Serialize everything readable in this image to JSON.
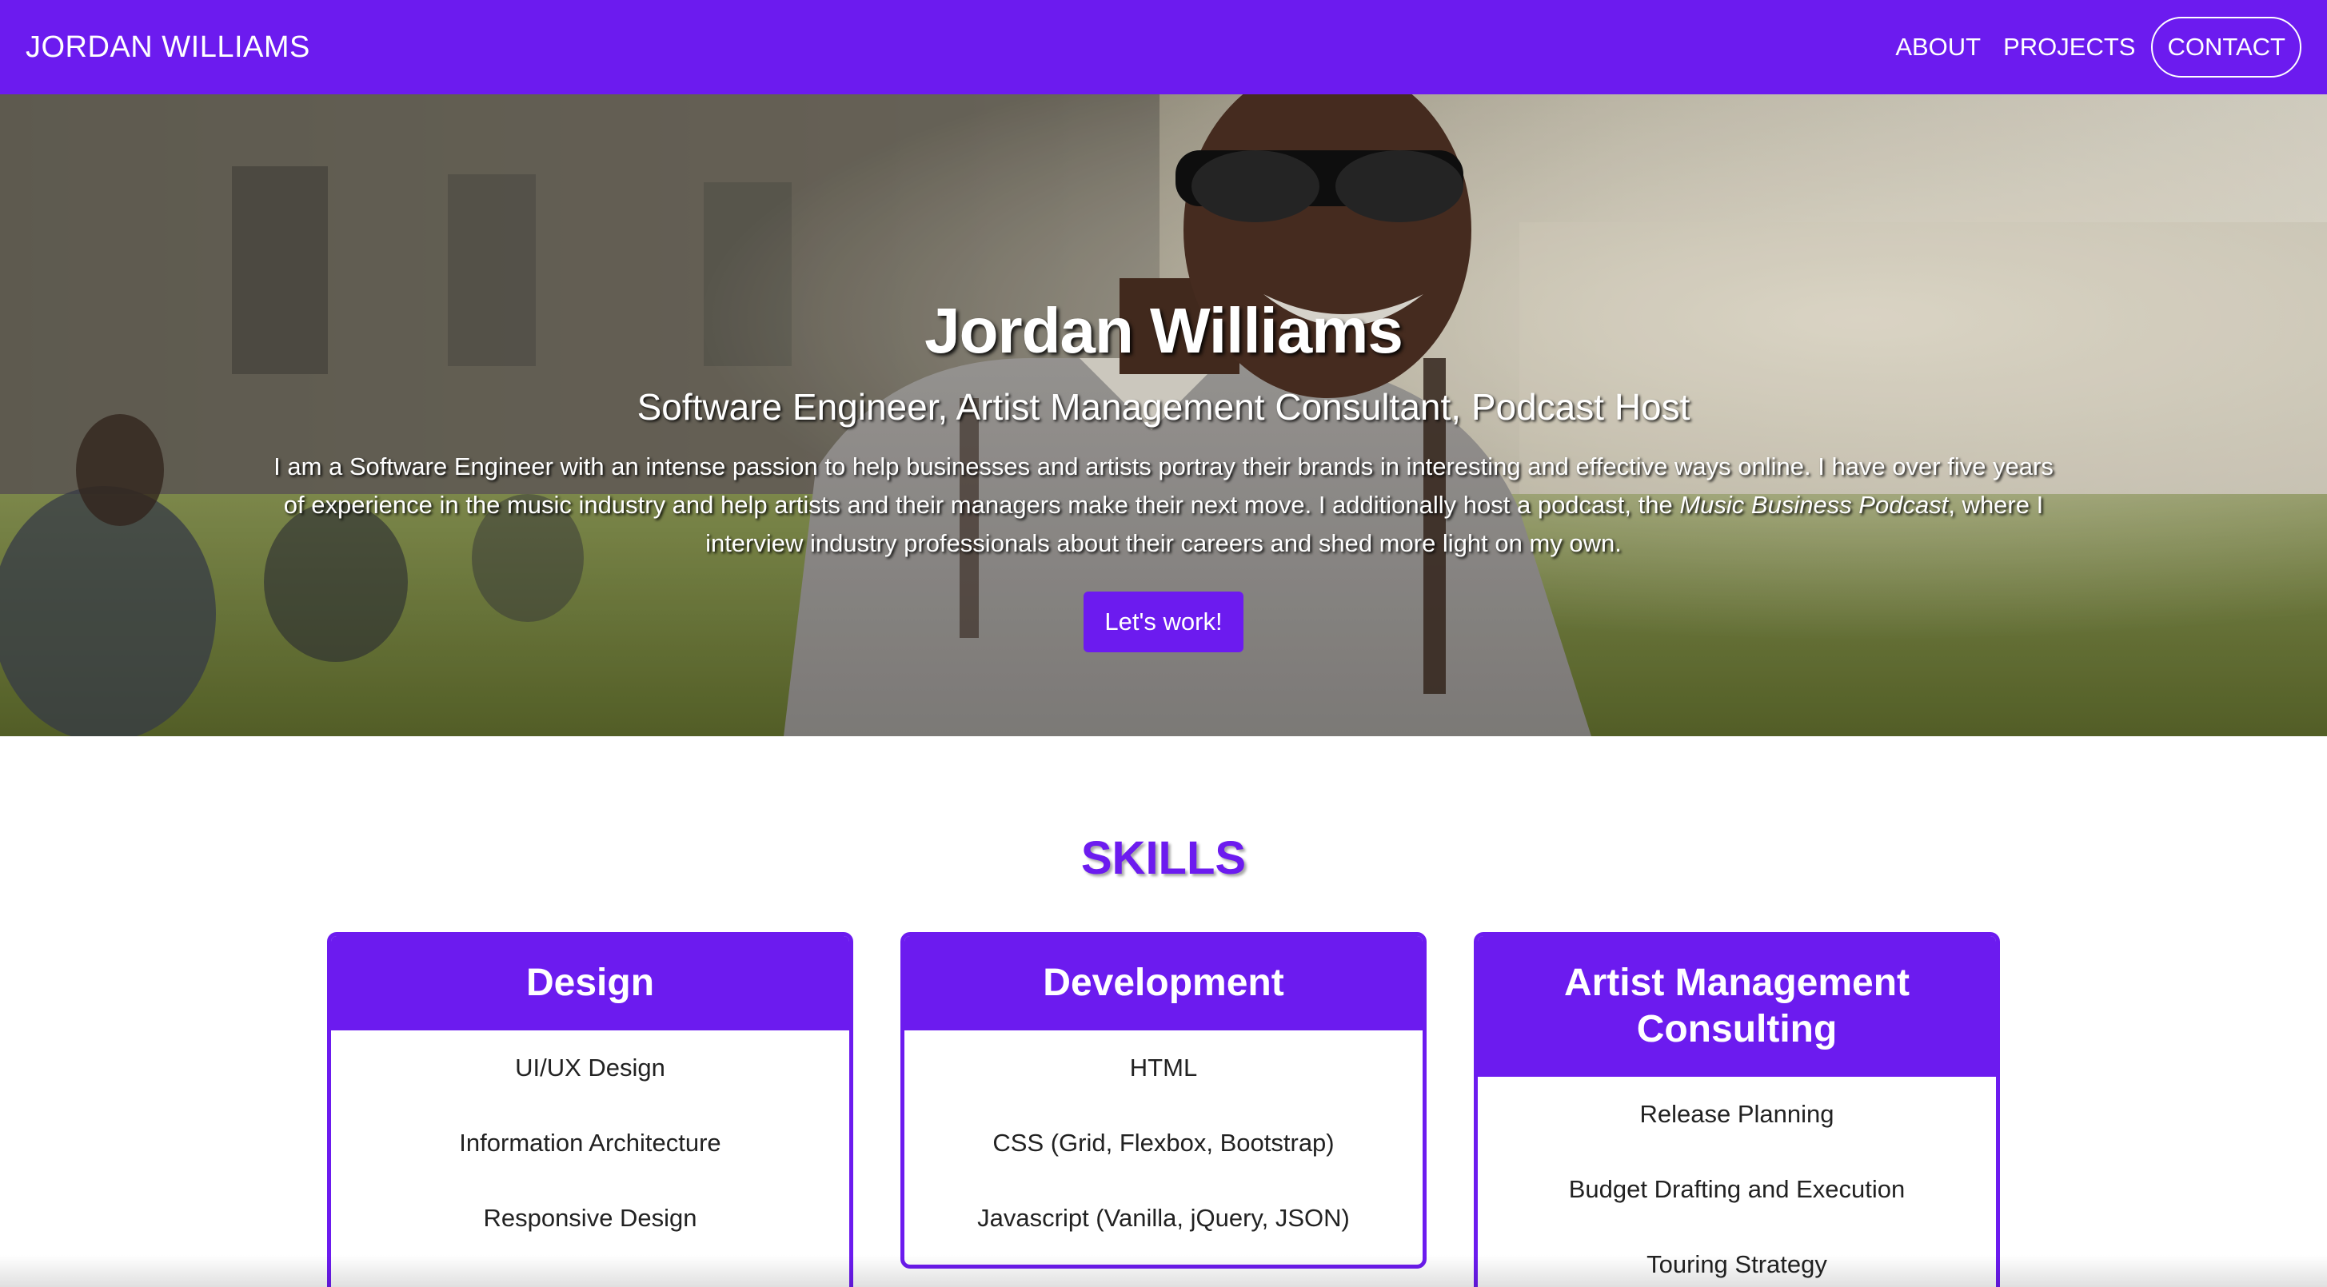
{
  "navbar": {
    "brand": "JORDAN WILLIAMS",
    "links": [
      {
        "label": "ABOUT"
      },
      {
        "label": "PROJECTS"
      },
      {
        "label": "CONTACT"
      }
    ]
  },
  "hero": {
    "name": "Jordan Williams",
    "subtitle": "Software Engineer, Artist Management Consultant, Podcast Host",
    "bio_part1": "I am a Software Engineer with an intense passion to help businesses and artists portray their brands in interesting and effective ways online. I have over five years of experience in the music industry and help artists and their managers make their next move. I additionally host a podcast, the ",
    "bio_podcast": "Music Business Podcast",
    "bio_part2": ", where I interview industry professionals about their careers and shed more light on my own.",
    "cta_label": "Let's work!"
  },
  "skills": {
    "title": "SKILLS",
    "cards": [
      {
        "title": "Design",
        "items": [
          "UI/UX Design",
          "Information Architecture",
          "Responsive Design"
        ]
      },
      {
        "title": "Development",
        "items": [
          "HTML",
          "CSS (Grid, Flexbox, Bootstrap)",
          "Javascript (Vanilla, jQuery, JSON)"
        ]
      },
      {
        "title": "Artist Management Consulting",
        "items": [
          "Release Planning",
          "Budget Drafting and Execution",
          "Touring Strategy"
        ]
      }
    ]
  },
  "colors": {
    "brand_purple": "#6c1bef",
    "text_dark": "#222222",
    "white": "#ffffff"
  }
}
